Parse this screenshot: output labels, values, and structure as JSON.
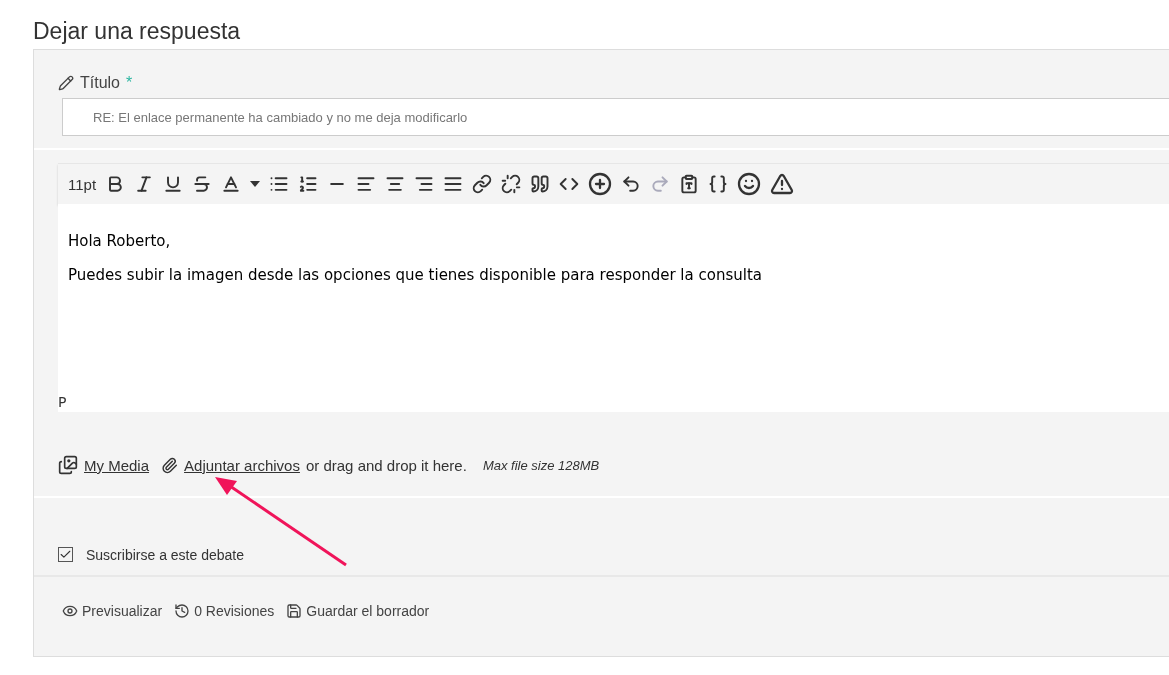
{
  "heading": "Dejar una respuesta",
  "title_field": {
    "label": "Título",
    "required_mark": "*",
    "value": "RE: El enlace permanente ha cambiado y no me deja modificarlo"
  },
  "toolbar": [
    {
      "kind": "font-size",
      "label": "11pt",
      "disabled": false
    },
    {
      "kind": "bold",
      "disabled": false
    },
    {
      "kind": "italic",
      "disabled": false
    },
    {
      "kind": "underline",
      "disabled": false
    },
    {
      "kind": "strikethrough",
      "disabled": false
    },
    {
      "kind": "text-color",
      "disabled": false
    },
    {
      "kind": "caret",
      "disabled": false
    },
    {
      "kind": "bullet-list",
      "disabled": false
    },
    {
      "kind": "numbered-list",
      "disabled": false
    },
    {
      "kind": "horizontal-rule",
      "disabled": false
    },
    {
      "kind": "align-left",
      "disabled": false
    },
    {
      "kind": "align-center",
      "disabled": false
    },
    {
      "kind": "align-right",
      "disabled": false
    },
    {
      "kind": "justify",
      "disabled": false
    },
    {
      "kind": "link",
      "disabled": false
    },
    {
      "kind": "unlink",
      "disabled": false
    },
    {
      "kind": "quote",
      "disabled": false
    },
    {
      "kind": "code",
      "disabled": false
    },
    {
      "kind": "insert",
      "disabled": false
    },
    {
      "kind": "undo",
      "disabled": false
    },
    {
      "kind": "redo",
      "disabled": true
    },
    {
      "kind": "paste-text",
      "disabled": false
    },
    {
      "kind": "code-block",
      "disabled": false
    },
    {
      "kind": "emoji",
      "disabled": false
    },
    {
      "kind": "warning",
      "disabled": false
    }
  ],
  "editor": {
    "paragraphs": [
      "Hola Roberto,",
      "Puedes subir la imagen desde las opciones que tienes disponible para responder la consulta"
    ],
    "path": "P"
  },
  "attachments": {
    "media_link": "My Media",
    "attach_link": "Adjuntar archivos",
    "drop_text": "or drag and drop it here.",
    "max_size": "Max file size 128MB"
  },
  "subscribe": {
    "label": "Suscribirse a este debate",
    "checked": true
  },
  "footer": [
    {
      "kind": "preview",
      "label": "Previsualizar"
    },
    {
      "kind": "revisions",
      "label": "0 Revisiones"
    },
    {
      "kind": "save",
      "label": "Guardar el borrador"
    }
  ]
}
